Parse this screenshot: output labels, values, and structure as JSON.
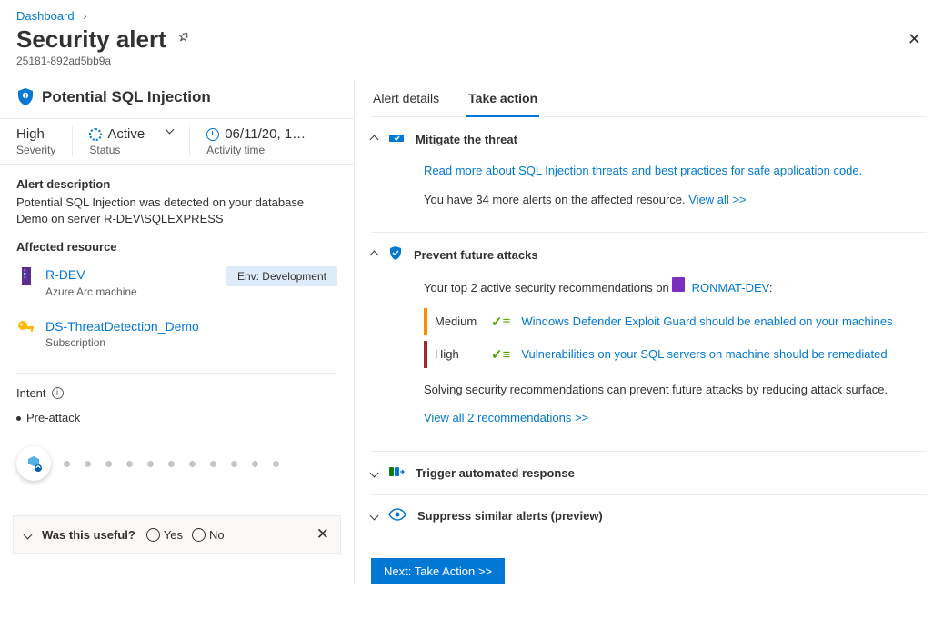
{
  "breadcrumb": {
    "root": "Dashboard"
  },
  "page": {
    "title": "Security alert",
    "id": "25181-892ad5bb9a"
  },
  "alert": {
    "name": "Potential SQL Injection",
    "severity": {
      "value": "High",
      "label": "Severity"
    },
    "status": {
      "value": "Active",
      "label": "Status"
    },
    "activity": {
      "value": "06/11/20, 1…",
      "label": "Activity time"
    }
  },
  "description": {
    "heading": "Alert description",
    "text": "Potential SQL Injection was detected on your database Demo on server R-DEV\\SQLEXPRESS"
  },
  "affected": {
    "heading": "Affected resource",
    "items": [
      {
        "name": "R-DEV",
        "type": "Azure Arc machine",
        "env": "Env: Development"
      },
      {
        "name": "DS-ThreatDetection_Demo",
        "type": "Subscription"
      }
    ]
  },
  "intent": {
    "label": "Intent",
    "stage": "Pre-attack"
  },
  "useful": {
    "question": "Was this useful?",
    "yes": "Yes",
    "no": "No"
  },
  "tabs": {
    "details": "Alert details",
    "action": "Take action"
  },
  "mitigate": {
    "title": "Mitigate the threat",
    "link": "Read more about SQL Injection threats and best practices for safe application code.",
    "more": "You have 34 more alerts on the affected resource. ",
    "viewall": "View all >>"
  },
  "prevent": {
    "title": "Prevent future attacks",
    "intro1": "Your top 2 active security recommendations on ",
    "machine": "RONMAT-DEV",
    "colon": ":",
    "recs": [
      {
        "sev": "Medium",
        "text": "Windows Defender Exploit Guard should be enabled on your machines"
      },
      {
        "sev": "High",
        "text": "Vulnerabilities on your SQL servers on machine should be remediated"
      }
    ],
    "solving": "Solving security recommendations can prevent future attacks by reducing attack surface.",
    "viewrecs": "View all 2 recommendations >>"
  },
  "trigger": {
    "title": "Trigger automated response"
  },
  "suppress": {
    "title": "Suppress similar alerts (preview)"
  },
  "next_btn": "Next: Take Action >>"
}
